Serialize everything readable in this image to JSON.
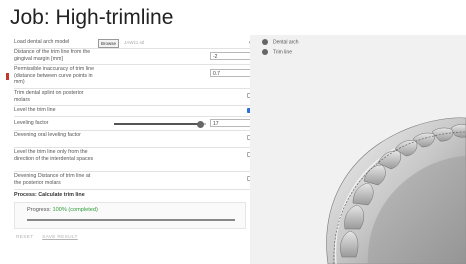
{
  "title": "Job: High-trimline",
  "params": {
    "load_label": "Load dental arch model",
    "browse_label": "Browse",
    "file_name": "JAW11.stl",
    "distance_label": "Distance of the trim line from the gingival margin [mm]",
    "distance_value": "-2",
    "inaccuracy_label": "Permissible inaccuracy of trim line (distance between curve points in mm)",
    "inaccuracy_value": "0.7",
    "trim_splint_label": "Trim dental splint on posterior molars",
    "trim_splint_checked": false,
    "level_label": "Level the trim line",
    "level_checked": true,
    "leveling_factor_label": "Leveling factor",
    "leveling_factor_value": "17",
    "leveling_factor_fraction": 0.94,
    "devening_oral_label": "Devening oral leveling factor",
    "devening_oral_checked": false,
    "level_only_label": "Level the trim line only from the direction of the interdental spaces",
    "level_only_checked": false,
    "devening_distance_label": "Devening Distance of trim line at the posterior molars",
    "devening_distance_checked": false
  },
  "process": {
    "label": "Process: Calculate trim line",
    "progress_prefix": "Progress:",
    "progress_status": "100% (completed)",
    "progress_fraction": 1.0
  },
  "actions": {
    "reset": "RESET",
    "save": "SAVE RESULT"
  },
  "viewer": {
    "layers": [
      {
        "label": "Dental arch"
      },
      {
        "label": "Trim line"
      }
    ]
  },
  "colors": {
    "accent": "#c0392b",
    "checked": "#2c6fd6",
    "completed": "#2e9b3a"
  }
}
